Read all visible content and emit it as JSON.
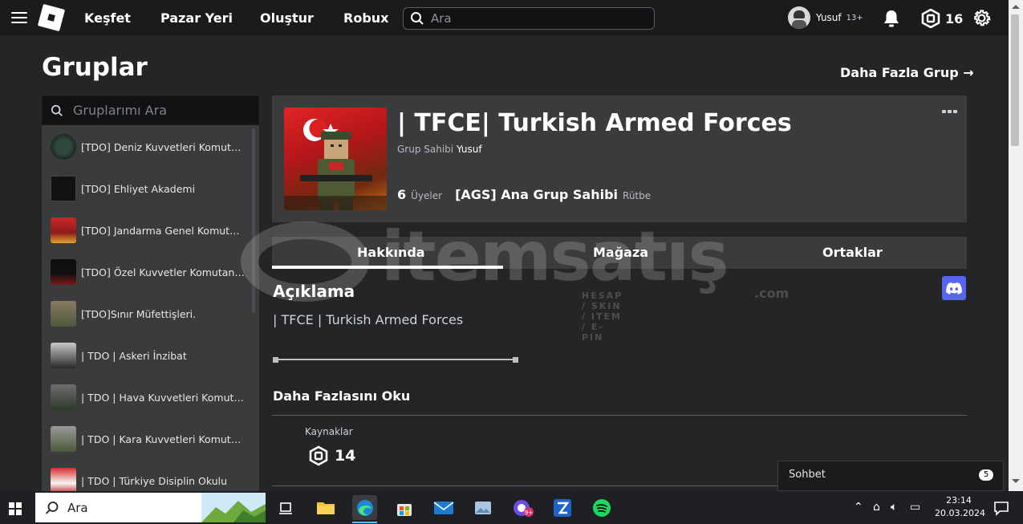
{
  "nav": {
    "links": [
      "Keşfet",
      "Pazar Yeri",
      "Oluştur",
      "Robux"
    ],
    "search_placeholder": "Ara",
    "user_name": "Yusuf",
    "user_age": "13+",
    "robux": "16"
  },
  "page": {
    "title": "Gruplar",
    "more_groups": "Daha Fazla Grup →"
  },
  "sidebar": {
    "search_placeholder": "Gruplarımı Ara",
    "groups": [
      "[TDO] Deniz Kuvvetleri Komutanlığı",
      "[TDO] Ehliyet Akademi",
      "[TDO] Jandarma Genel Komutanlığı",
      "[TDO] Özel Kuvvetler Komutanlığı",
      "[TDO]Sınır Müfettişleri.",
      "| TDO | Askeri İnzibat",
      "| TDO | Hava Kuvvetleri Komutanlığı",
      "| TDO | Kara Kuvvetleri Komutanlığı",
      "| TDO | Türkiye Disiplin Okulu"
    ]
  },
  "group": {
    "name": "| TFCE| Turkish Armed Forces",
    "owner_label": "Grup Sahibi",
    "owner_name": "Yusuf",
    "members_count": "6",
    "members_label": "Üyeler",
    "rank_name": "[AGS] Ana Grup Sahibi",
    "rank_label": "Rütbe"
  },
  "tabs": [
    "Hakkında",
    "Mağaza",
    "Ortaklar"
  ],
  "about": {
    "heading": "Açıklama",
    "description": "| TFCE | Turkish Armed Forces",
    "read_more": "Daha Fazlasını Oku",
    "resources_label": "Kaynaklar",
    "resources_value": "14"
  },
  "chat": {
    "label": "Sohbet",
    "badge": "5"
  },
  "watermark": {
    "brand": "itemsatış",
    "tagline": "HESAP / SKIN / ITEM / E-PIN",
    "suffix": ".com"
  },
  "taskbar": {
    "search_placeholder": "Ara",
    "time": "23:14",
    "date": "20.03.2024"
  },
  "colors": {
    "page_bg": "#232527",
    "card_bg": "#393b3d",
    "topbar_bg": "#191b1d",
    "discord": "#5865f2",
    "taskbar_accent": "#4cc2ff"
  }
}
